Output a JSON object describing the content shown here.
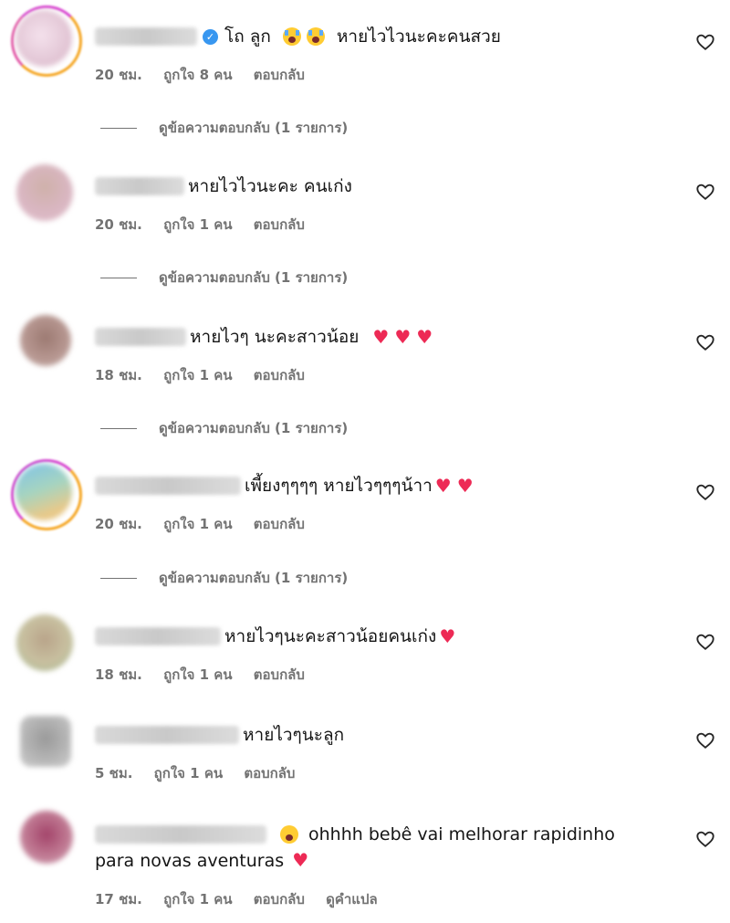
{
  "comments": [
    {
      "text_a": "โถ ลูก",
      "text_b": "หายไวไวนะคะคนสวย",
      "time": "20 ชม.",
      "likes": "ถูกใจ 8 คน",
      "reply": "ตอบกลับ",
      "view_replies": "ดูข้อความตอบกลับ (1 รายการ)",
      "verified": true,
      "emojis": [
        "loudly-crying-face",
        "loudly-crying-face"
      ]
    },
    {
      "text": "หายไวไวนะคะ คนเก่ง",
      "time": "20 ชม.",
      "likes": "ถูกใจ 1 คน",
      "reply": "ตอบกลับ",
      "view_replies": "ดูข้อความตอบกลับ (1 รายการ)"
    },
    {
      "text": "หายไวๆ นะคะสาวน้อย",
      "time": "18 ชม.",
      "likes": "ถูกใจ 1 คน",
      "reply": "ตอบกลับ",
      "view_replies": "ดูข้อความตอบกลับ (1 รายการ)",
      "emojis": [
        "heart",
        "heart",
        "heart"
      ]
    },
    {
      "text": "เพี้ยงๆๆๆๆ หายไวๆๆๆน้าา",
      "time": "20 ชม.",
      "likes": "ถูกใจ 1 คน",
      "reply": "ตอบกลับ",
      "view_replies": "ดูข้อความตอบกลับ (1 รายการ)",
      "emojis": [
        "heart",
        "heart"
      ]
    },
    {
      "text": "หายไวๆนะคะสาวน้อยคนเก่ง",
      "time": "18 ชม.",
      "likes": "ถูกใจ 1 คน",
      "reply": "ตอบกลับ",
      "emojis": [
        "heart"
      ]
    },
    {
      "text": "หายไวๆนะลูก",
      "time": "5 ชม.",
      "likes": "ถูกใจ 1 คน",
      "reply": "ตอบกลับ"
    },
    {
      "text_line1": "ohhhh bebê vai melhorar rapidinho",
      "text_line2": "para novas aventuras",
      "time": "17 ชม.",
      "likes": "ถูกใจ 1 คน",
      "reply": "ตอบกลับ",
      "translate": "ดูคำแปล",
      "emojis": [
        "flushed-face",
        "heart"
      ]
    }
  ],
  "colors": {
    "meta_text": "#737373",
    "heart": "#ed2a55",
    "verified": "#3897f0"
  },
  "icons": {
    "like": "heart-outline-icon"
  }
}
